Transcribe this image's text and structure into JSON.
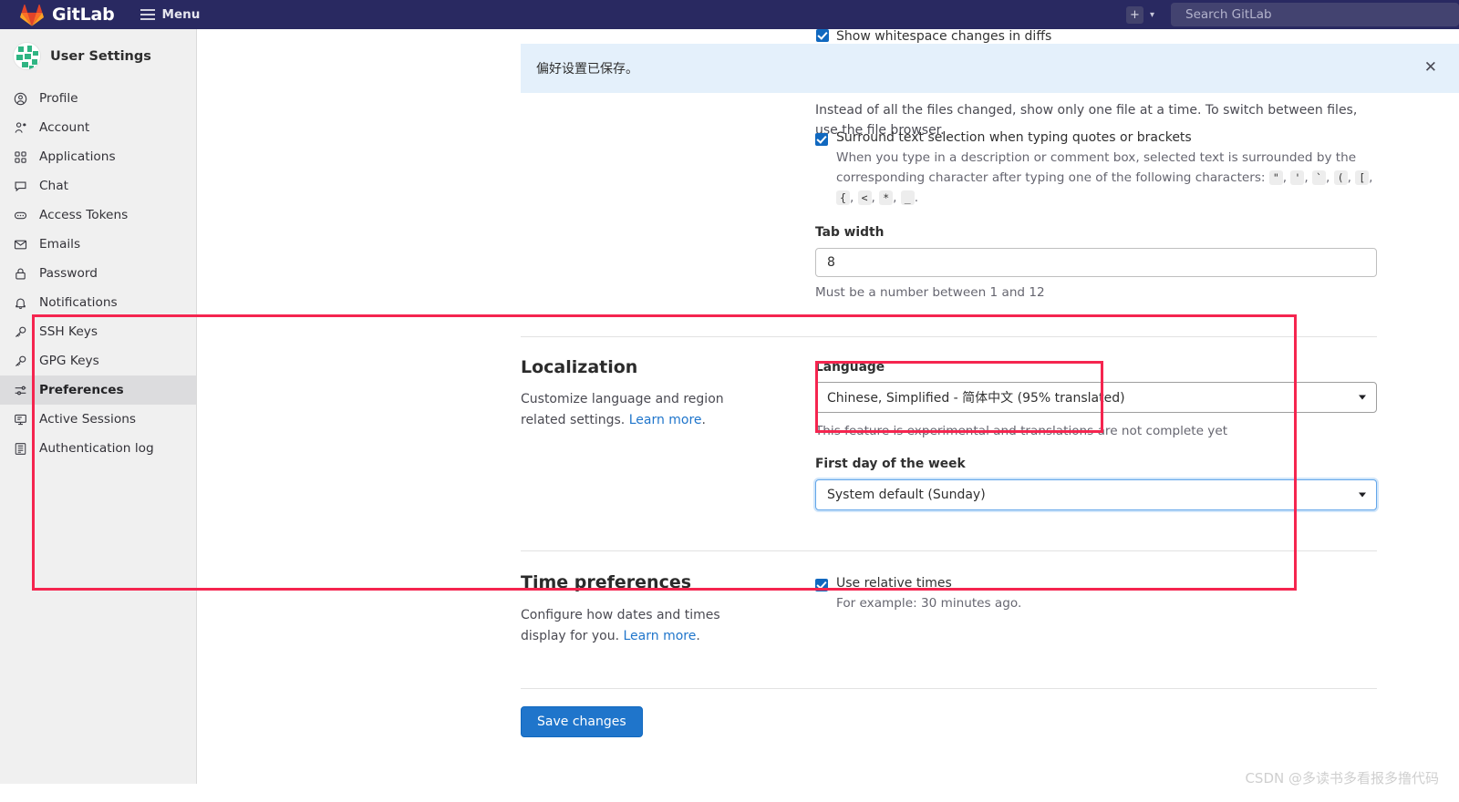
{
  "navbar": {
    "brand": "GitLab",
    "menu_label": "Menu",
    "plus_icon": "plus-icon",
    "plus_chevron_icon": "chevron-down-icon",
    "search_placeholder": "Search GitLab",
    "search_value": "",
    "bg_color": "#292961"
  },
  "sidebar": {
    "title": "User Settings",
    "avatar_icon": "user-avatar",
    "items": [
      {
        "label": "Profile",
        "icon": "user-circle-icon",
        "active": false
      },
      {
        "label": "Account",
        "icon": "account-icon",
        "active": false
      },
      {
        "label": "Applications",
        "icon": "applications-icon",
        "active": false
      },
      {
        "label": "Chat",
        "icon": "chat-icon",
        "active": false
      },
      {
        "label": "Access Tokens",
        "icon": "token-icon",
        "active": false
      },
      {
        "label": "Emails",
        "icon": "envelope-icon",
        "active": false
      },
      {
        "label": "Password",
        "icon": "lock-icon",
        "active": false
      },
      {
        "label": "Notifications",
        "icon": "bell-icon",
        "active": false
      },
      {
        "label": "SSH Keys",
        "icon": "key-icon",
        "active": false
      },
      {
        "label": "GPG Keys",
        "icon": "key-icon",
        "active": false
      },
      {
        "label": "Preferences",
        "icon": "preferences-icon",
        "active": true
      },
      {
        "label": "Active Sessions",
        "icon": "monitor-icon",
        "active": false
      },
      {
        "label": "Authentication log",
        "icon": "log-icon",
        "active": false
      }
    ]
  },
  "alert": {
    "message": "偏好设置已保存。",
    "close_icon": "close-icon",
    "bg_color": "#e4f0fb"
  },
  "behavior": {
    "whitespace_checkbox_label": "Show whitespace changes in diffs",
    "file_browser_help": "Instead of all the files changed, show only one file at a time. To switch between files, use the file browser.",
    "surround_checkbox_label": "Surround text selection when typing quotes or brackets",
    "surround_help_prefix": "When you type in a description or comment box, selected text is surrounded by the corresponding character after typing one of the following characters:",
    "surround_chars": [
      "\"",
      "'",
      "`",
      "(",
      "[",
      "{",
      "<",
      "*",
      "_"
    ],
    "tab_width_label": "Tab width",
    "tab_width_value": "8",
    "tab_width_help": "Must be a number between 1 and 12"
  },
  "localization": {
    "section_title": "Localization",
    "section_desc": "Customize language and region related settings.",
    "section_desc_link": "Learn more",
    "language_label": "Language",
    "language_value": "Chinese, Simplified - 简体中文 (95% translated)",
    "language_help": "This feature is experimental and translations are not complete yet",
    "first_day_label": "First day of the week",
    "first_day_value": "System default (Sunday)"
  },
  "time_preferences": {
    "section_title": "Time preferences",
    "section_desc": "Configure how dates and times display for you.",
    "section_desc_link": "Learn more",
    "relative_times_label": "Use relative times",
    "relative_times_help": "For example: 30 minutes ago."
  },
  "footer": {
    "save_label": "Save changes"
  },
  "annotations": {
    "highlight_color": "#f5254f"
  },
  "watermark": {
    "text": "CSDN @多读书多看报多撸代码"
  }
}
